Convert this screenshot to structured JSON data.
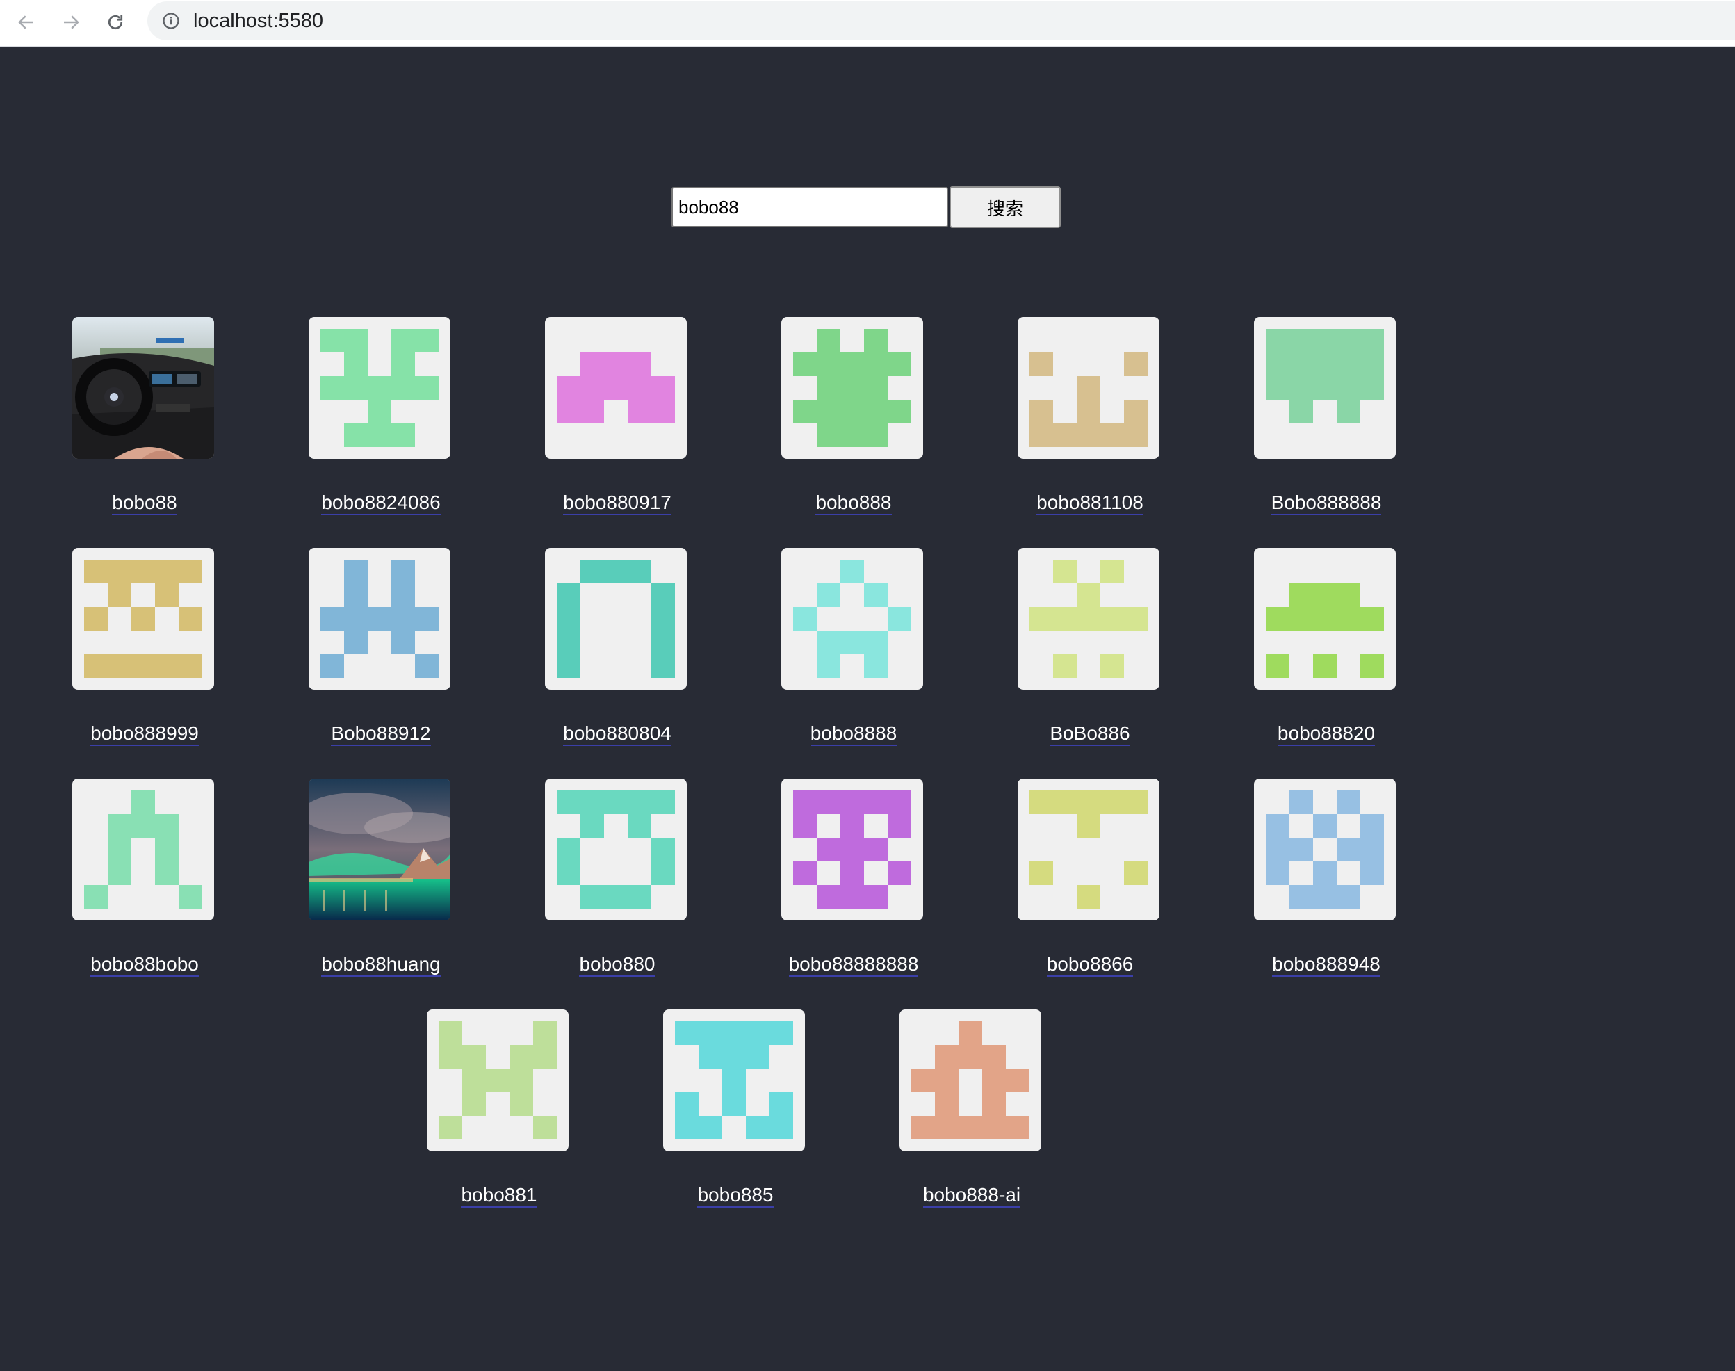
{
  "browser": {
    "url": "localhost:5580",
    "back_icon": "arrow-left-icon",
    "forward_icon": "arrow-right-icon",
    "reload_icon": "reload-icon",
    "site_info_icon": "info-icon"
  },
  "search": {
    "value": "bobo88",
    "button_label": "搜索"
  },
  "users": [
    {
      "name": "bobo88",
      "avatar": "photo-car-interior"
    },
    {
      "name": "bobo8824086",
      "avatar": "identicon",
      "color": "#86e2a8"
    },
    {
      "name": "bobo880917",
      "avatar": "identicon",
      "color": "#e184e0"
    },
    {
      "name": "bobo888",
      "avatar": "identicon",
      "color": "#7fd68a"
    },
    {
      "name": "bobo881108",
      "avatar": "identicon",
      "color": "#d7c090"
    },
    {
      "name": "Bobo888888",
      "avatar": "identicon",
      "color": "#8ad6a7"
    },
    {
      "name": "bobo888999",
      "avatar": "identicon",
      "color": "#d7c177"
    },
    {
      "name": "Bobo88912",
      "avatar": "identicon",
      "color": "#81b6d8"
    },
    {
      "name": "bobo880804",
      "avatar": "identicon",
      "color": "#59cdba"
    },
    {
      "name": "bobo8888",
      "avatar": "identicon",
      "color": "#8ae6de"
    },
    {
      "name": "BoBo886",
      "avatar": "identicon",
      "color": "#d5e591"
    },
    {
      "name": "bobo88820",
      "avatar": "identicon",
      "color": "#9fdb5e"
    },
    {
      "name": "bobo88bobo",
      "avatar": "identicon",
      "color": "#89e0b4"
    },
    {
      "name": "bobo88huang",
      "avatar": "photo-aurora-landscape"
    },
    {
      "name": "bobo880",
      "avatar": "identicon",
      "color": "#6ad9c0"
    },
    {
      "name": "bobo88888888",
      "avatar": "identicon",
      "color": "#bf6bdd"
    },
    {
      "name": "bobo8866",
      "avatar": "identicon",
      "color": "#d5db7f"
    },
    {
      "name": "bobo888948",
      "avatar": "identicon",
      "color": "#97c0e3"
    },
    {
      "name": "bobo881",
      "avatar": "identicon",
      "color": "#bedf9a"
    },
    {
      "name": "bobo885",
      "avatar": "identicon",
      "color": "#6adbdd"
    },
    {
      "name": "bobo888-ai",
      "avatar": "identicon",
      "color": "#e2a488"
    }
  ]
}
